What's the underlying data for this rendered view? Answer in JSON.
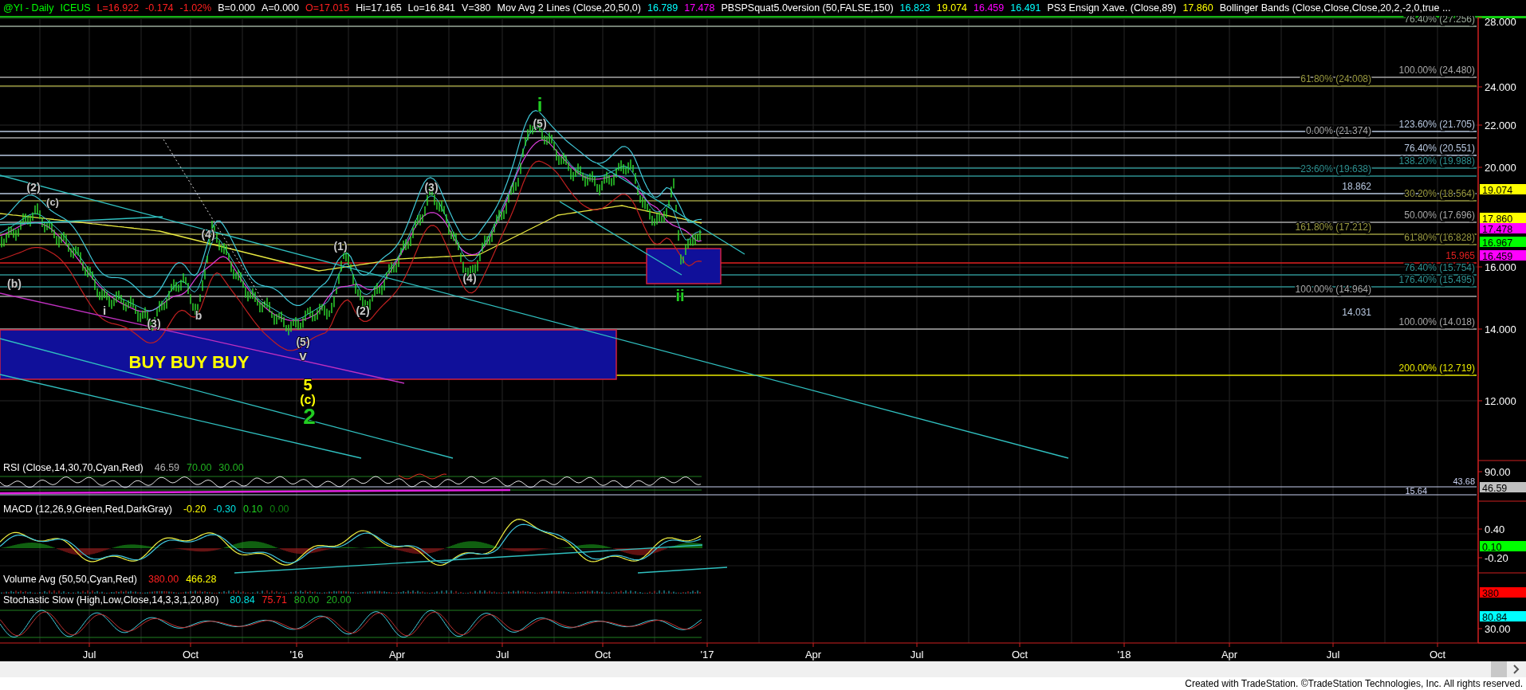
{
  "header": {
    "items": [
      {
        "text": "@YI - Daily",
        "color": "#00ff00"
      },
      {
        "text": "ICEUS",
        "color": "#00ff00"
      },
      {
        "text": "L=16.922",
        "color": "#ff2020"
      },
      {
        "text": "-0.174",
        "color": "#ff2020"
      },
      {
        "text": "-1.02%",
        "color": "#ff2020"
      },
      {
        "text": "B=0.000",
        "color": "#ffffff"
      },
      {
        "text": "A=0.000",
        "color": "#ffffff"
      },
      {
        "text": "O=17.015",
        "color": "#ff2020"
      },
      {
        "text": "Hi=17.165",
        "color": "#ffffff"
      },
      {
        "text": "Lo=16.841",
        "color": "#ffffff"
      },
      {
        "text": "V=380",
        "color": "#ffffff"
      },
      {
        "text": "Mov Avg 2 Lines (Close,20,50,0)",
        "color": "#ffffff"
      },
      {
        "text": "16.789",
        "color": "#00ffff"
      },
      {
        "text": "17.478",
        "color": "#ff00ff"
      },
      {
        "text": "PBSPSquat5.0version (50,FALSE,150)",
        "color": "#ffffff"
      },
      {
        "text": "16.823",
        "color": "#00ffff"
      },
      {
        "text": "19.074",
        "color": "#ffff00"
      },
      {
        "text": "16.459",
        "color": "#ff00ff"
      },
      {
        "text": "16.491",
        "color": "#00ffff"
      },
      {
        "text": "PS3 Ensign Xave. (Close,89)",
        "color": "#ffffff"
      },
      {
        "text": "17.860",
        "color": "#ffff00"
      },
      {
        "text": "Bollinger Bands (Close,Close,Close,20,2,-2,0,true ...",
        "color": "#ffffff"
      }
    ]
  },
  "fib_levels": [
    {
      "label": "76.40% (27.256)",
      "color": "#9aaa9a"
    },
    {
      "label": "100.00% (24.480)",
      "color": "#a8a8a8"
    },
    {
      "label": "61.80% (24.008)",
      "color": "#9a9a40"
    },
    {
      "label": "123.60% (21.705)",
      "color": "#b8c8e0"
    },
    {
      "label": "0.00% (21.374)",
      "color": "#a8a8a8"
    },
    {
      "label": "76.40% (20.551)",
      "color": "#b8c8e0"
    },
    {
      "label": "138.20% (19.988)",
      "color": "#2e9090"
    },
    {
      "label": "23.60% (19.638)",
      "color": "#2e9090"
    },
    {
      "label": "18.862",
      "color": "#b8c8e0"
    },
    {
      "label": "30.20% (18.564)",
      "color": "#9a9a40"
    },
    {
      "label": "50.00% (17.696)",
      "color": "#a8a8a8"
    },
    {
      "label": "161.80% (17.212)",
      "color": "#9a9a40"
    },
    {
      "label": "61.80% (16.828)",
      "color": "#9a9a40"
    },
    {
      "label": "15.965",
      "color": "#e02020"
    },
    {
      "label": "76.40% (15.754)",
      "color": "#2e9090"
    },
    {
      "label": "176.40% (15.495)",
      "color": "#2e9090"
    },
    {
      "label": "100.00% (14.964)",
      "color": "#a8a8a8"
    },
    {
      "label": "100.00% (14.018)",
      "color": "#a8a8a8"
    },
    {
      "label": "14.031",
      "color": "#b8c8e0"
    },
    {
      "label": "200.00% (12.719)",
      "color": "#e8e800"
    }
  ],
  "wave_labels": [
    {
      "text": "i",
      "color": "#22cc22"
    },
    {
      "text": "(5)",
      "color": "#c8c8c8"
    },
    {
      "text": "(3)",
      "color": "#c8c8c8"
    },
    {
      "text": "(2)",
      "color": "#c8c8c8"
    },
    {
      "text": "(c)",
      "color": "#c8c8c8"
    },
    {
      "text": "(4)",
      "color": "#c8c8c8"
    },
    {
      "text": "(1)",
      "color": "#c8c8c8"
    },
    {
      "text": "(b)",
      "color": "#c8c8c8"
    },
    {
      "text": "i",
      "color": "#c8c8c8"
    },
    {
      "text": "(4)",
      "color": "#c8c8c8"
    },
    {
      "text": "b",
      "color": "#c8c8c8"
    },
    {
      "text": "(2)",
      "color": "#c8c8c8"
    },
    {
      "text": "(3)",
      "color": "#c8c8c8"
    },
    {
      "text": "(5)",
      "color": "#c8c8c8"
    },
    {
      "text": "v",
      "color": "#c8c8c8"
    },
    {
      "text": "5",
      "color": "#ffff00"
    },
    {
      "text": "(c)",
      "color": "#ffff00"
    },
    {
      "text": "2",
      "color": "#22cc22"
    },
    {
      "text": "ii",
      "color": "#22cc22"
    }
  ],
  "buy_zone_label": "BUY BUY BUY",
  "price_axis": {
    "ticks": [
      "28.000",
      "24.000",
      "22.000",
      "20.000",
      "16.000",
      "14.000",
      "12.000"
    ],
    "markers": [
      {
        "text": "19.074",
        "color": "#ffff00"
      },
      {
        "text": "17.860",
        "color": "#ffff00"
      },
      {
        "text": "17.478",
        "color": "#ff00ff"
      },
      {
        "text": "16.967",
        "color": "#00ff00"
      },
      {
        "text": "16.459",
        "color": "#ff00ff"
      }
    ]
  },
  "panels": [
    {
      "title": "RSI (Close,14,30,70,Cyan,Red)",
      "values": [
        {
          "text": "46.59",
          "color": "#b0b0b0"
        },
        {
          "text": "70.00",
          "color": "#20b020"
        },
        {
          "text": "30.00",
          "color": "#20b020"
        }
      ]
    },
    {
      "title": "MACD (12,26,9,Green,Red,DarkGray)",
      "values": [
        {
          "text": "-0.20",
          "color": "#ffff00"
        },
        {
          "text": "-0.30",
          "color": "#00e0e0"
        },
        {
          "text": "0.10",
          "color": "#20d020"
        },
        {
          "text": "0.00",
          "color": "#108010"
        }
      ]
    },
    {
      "title": "Volume Avg (50,50,Cyan,Red)",
      "values": [
        {
          "text": "380.00",
          "color": "#ff2020"
        },
        {
          "text": "466.28",
          "color": "#ffff00"
        }
      ]
    },
    {
      "title": "Stochastic Slow (High,Low,Close,14,3,3,1,20,80)",
      "values": [
        {
          "text": "80.84",
          "color": "#00e0e0"
        },
        {
          "text": "75.71",
          "color": "#ff2020"
        },
        {
          "text": "80.00",
          "color": "#20b020"
        },
        {
          "text": "20.00",
          "color": "#20b020"
        }
      ]
    }
  ],
  "rsi_levels": [
    "43.68",
    "15.64"
  ],
  "indicator_axis": {
    "ticks": [
      "90.00",
      "0.40",
      "-0.20",
      "30.00"
    ],
    "markers": [
      {
        "text": "46.59",
        "color": "#c0c0c0"
      },
      {
        "text": "0.10",
        "color": "#00ff00"
      },
      {
        "text": "380",
        "color": "#ff0000"
      },
      {
        "text": "80.84",
        "color": "#00ffff"
      }
    ]
  },
  "time_axis": [
    "Jul",
    "Oct",
    "'16",
    "Apr",
    "Jul",
    "Oct",
    "'17",
    "Apr",
    "Jul",
    "Oct",
    "'18",
    "Apr",
    "Jul",
    "Oct"
  ],
  "footer": "Created with TradeStation. ©TradeStation Technologies, Inc. All rights reserved."
}
